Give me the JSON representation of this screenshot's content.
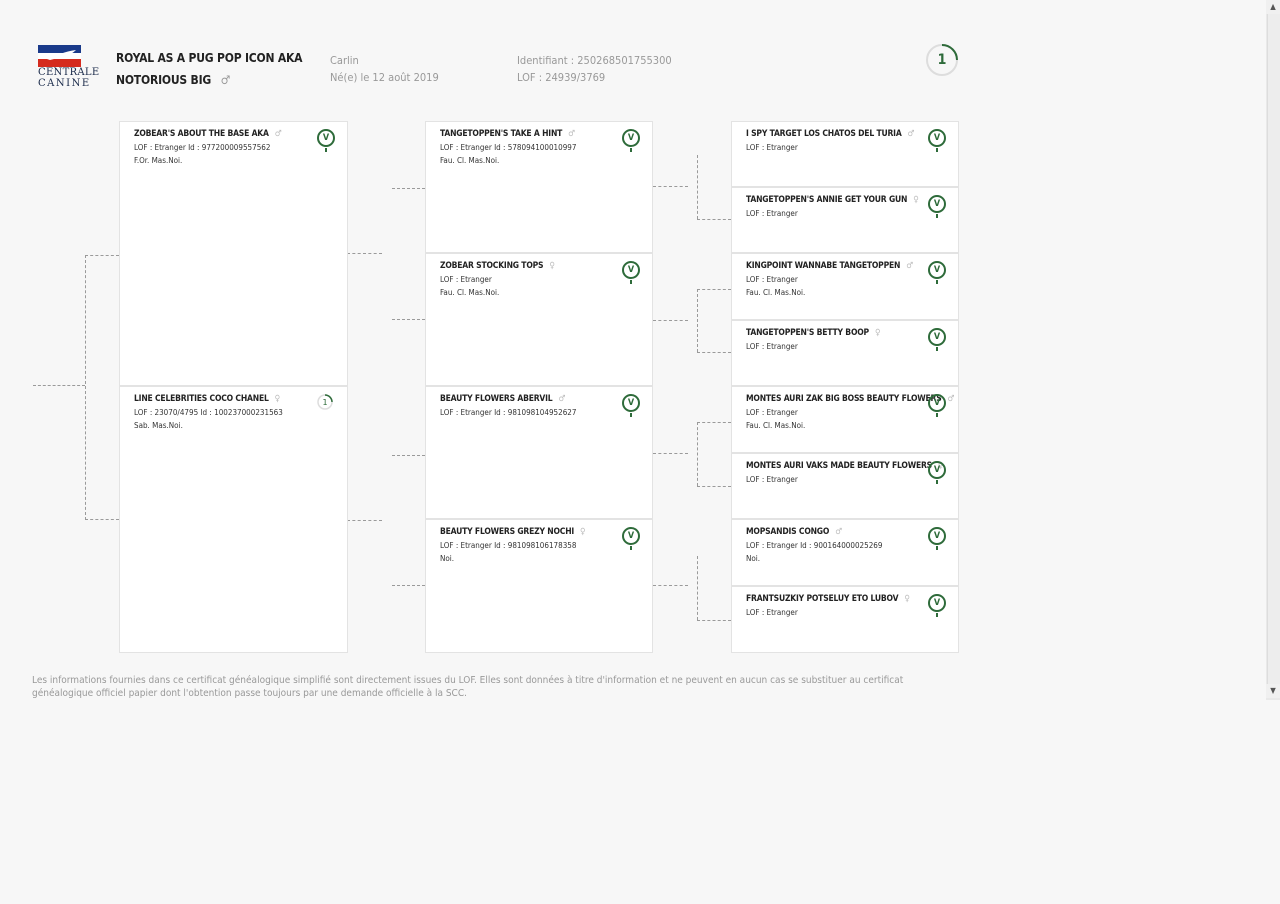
{
  "header": {
    "logo": {
      "line1": "CENTRALE",
      "line2": "CANINE"
    },
    "dog_name_line1": "ROYAL AS A PUG POP ICON AKA",
    "dog_name_line2": "NOTORIOUS BIG",
    "sex_symbol": "♂",
    "color": "Carlin",
    "birth": "Né(e) le 12 août 2019",
    "identifier": "Identifiant : 250268501755300",
    "lof": "LOF : 24939/3769",
    "generation": "1"
  },
  "pedigree": {
    "gen1": [
      {
        "name": "ZOBEAR'S ABOUT THE BASE AKA",
        "sex": "♂",
        "line1": "LOF : Etranger   Id : 977200009557562",
        "line2": "F.Or. Mas.Noi.",
        "badge": "V"
      },
      {
        "name": "LINE CELEBRITIES COCO CHANEL",
        "sex": "♀",
        "line1": "LOF : 23070/4795   Id : 100237000231563",
        "line2": "Sab. Mas.Noi.",
        "badge": "1"
      }
    ],
    "gen2": [
      {
        "name": "TANGETOPPEN'S TAKE A HINT",
        "sex": "♂",
        "line1": "LOF : Etranger   Id : 578094100010997",
        "line2": "Fau. Cl. Mas.Noi.",
        "badge": "V"
      },
      {
        "name": "ZOBEAR STOCKING TOPS",
        "sex": "♀",
        "line1": "LOF : Etranger",
        "line2": "Fau. Cl. Mas.Noi.",
        "badge": "V"
      },
      {
        "name": "BEAUTY FLOWERS ABERVIL",
        "sex": "♂",
        "line1": "LOF : Etranger   Id : 981098104952627",
        "line2": "",
        "badge": "V"
      },
      {
        "name": "BEAUTY FLOWERS GREZY NOCHI",
        "sex": "♀",
        "line1": "LOF : Etranger   Id : 981098106178358",
        "line2": "Noi.",
        "badge": "V"
      }
    ],
    "gen3": [
      {
        "name": "I SPY TARGET LOS CHATOS DEL TURIA",
        "sex": "♂",
        "line1": "LOF : Etranger",
        "line2": "",
        "badge": "V"
      },
      {
        "name": "TANGETOPPEN'S ANNIE GET YOUR GUN",
        "sex": "♀",
        "line1": "LOF : Etranger",
        "line2": "",
        "badge": "V"
      },
      {
        "name": "KINGPOINT WANNABE TANGETOPPEN",
        "sex": "♂",
        "line1": "LOF : Etranger",
        "line2": "Fau. Cl. Mas.Noi.",
        "badge": "V"
      },
      {
        "name": "TANGETOPPEN'S BETTY BOOP",
        "sex": "♀",
        "line1": "LOF : Etranger",
        "line2": "",
        "badge": "V"
      },
      {
        "name": "MONTES AURI ZAK BIG BOSS BEAUTY FLOWERS",
        "sex": "♂",
        "line1": "LOF : Etranger",
        "line2": "Fau. Cl. Mas.Noi.",
        "badge": "V"
      },
      {
        "name": "MONTES AURI VAKS MADE BEAUTY FLOWERS",
        "sex": "♀",
        "line1": "LOF : Etranger",
        "line2": "",
        "badge": "V"
      },
      {
        "name": "MOPSANDIS CONGO",
        "sex": "♂",
        "line1": "LOF : Etranger   Id : 900164000025269",
        "line2": "Noi.",
        "badge": "V"
      },
      {
        "name": "FRANTSUZKIY POTSELUY ETO LUBOV",
        "sex": "♀",
        "line1": "LOF : Etranger",
        "line2": "",
        "badge": "V"
      }
    ]
  },
  "disclaimer": "Les informations fournies dans ce certificat généalogique simplifié sont directement issues du LOF. Elles sont données à titre d'information et ne peuvent en aucun cas se substituer au certificat généalogique officiel papier dont l'obtention passe toujours par une demande officielle à la SCC.",
  "colors": {
    "accent_green": "#2e6b3a",
    "flag_blue": "#1a3a8a",
    "flag_red": "#d52b1e"
  },
  "scrollbar": {
    "up_icon": "up-arrow-icon",
    "down_icon": "down-arrow-icon"
  }
}
